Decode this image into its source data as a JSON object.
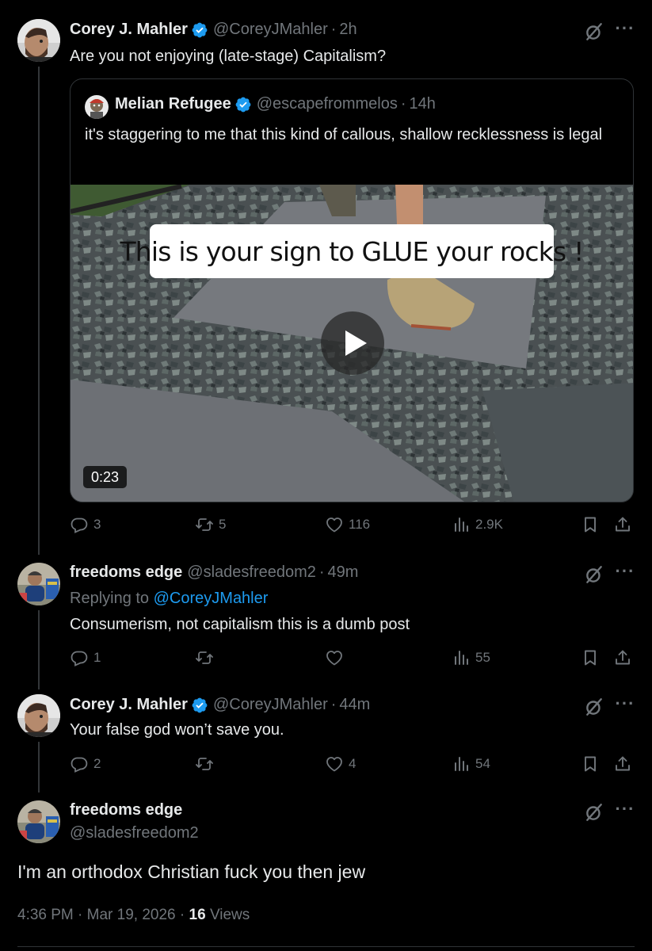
{
  "tweets": [
    {
      "author": "Corey J. Mahler",
      "handle": "@CoreyJMahler",
      "time": "2h",
      "text": "Are you not enjoying (late-stage) Capitalism?",
      "quote": {
        "author": "Melian Refugee",
        "handle": "@escapefrommelos",
        "time": "14h",
        "text": "it's staggering to me that this kind of callous, shallow recklessness is legal",
        "video_caption": "This is your sign to GLUE your rocks !",
        "video_duration": "0:23"
      },
      "stats": {
        "replies": "3",
        "reposts": "5",
        "likes": "116",
        "views": "2.9K"
      }
    },
    {
      "author": "freedoms edge",
      "handle": "@sladesfreedom2",
      "time": "49m",
      "replying_label": "Replying to",
      "replying_to": "@CoreyJMahler",
      "text": "Consumerism, not capitalism this is a dumb post",
      "stats": {
        "replies": "1",
        "reposts": "",
        "likes": "",
        "views": "55"
      }
    },
    {
      "author": "Corey J. Mahler",
      "handle": "@CoreyJMahler",
      "time": "44m",
      "text": "Your false god won’t save you.",
      "stats": {
        "replies": "2",
        "reposts": "",
        "likes": "4",
        "views": "54"
      }
    }
  ],
  "main_tweet": {
    "author": "freedoms edge",
    "handle": "@sladesfreedom2",
    "text": "I'm an orthodox  Christian  fuck you then jew",
    "time": "4:36 PM",
    "date": "Mar 19, 2026",
    "views_count": "16",
    "views_label": "Views"
  },
  "separator": "·",
  "icons": {
    "grok": "grok-slash-icon",
    "more": "more-icon",
    "reply": "reply-icon",
    "repost": "repost-icon",
    "like": "like-icon",
    "views": "views-icon",
    "bookmark": "bookmark-icon",
    "share": "share-icon",
    "verified": "verified-badge-icon",
    "play": "play-icon"
  },
  "colors": {
    "background": "#000000",
    "text": "#e7e9ea",
    "muted": "#71767b",
    "link": "#1d9bf0",
    "verified": "#1d9bf0",
    "border": "#2f3336"
  }
}
